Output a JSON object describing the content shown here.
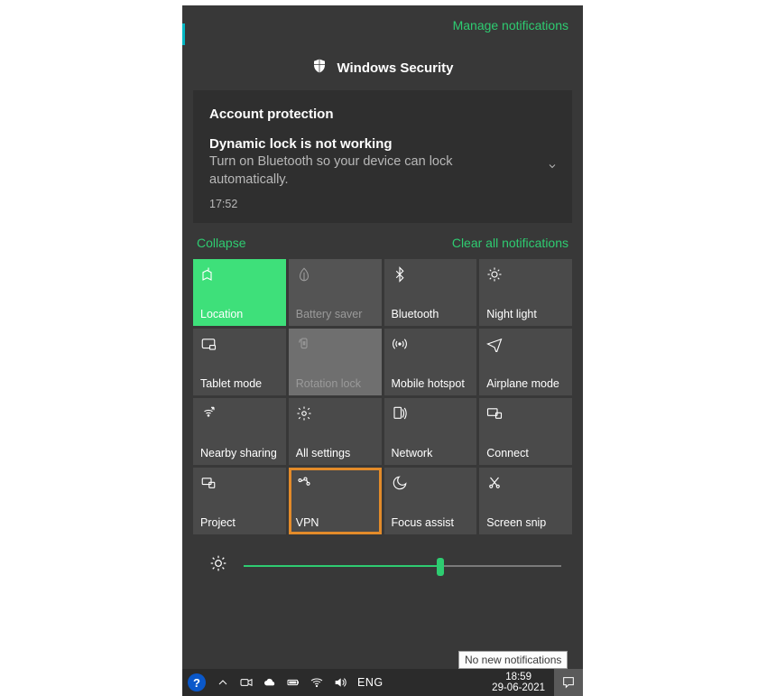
{
  "header": {
    "manage_link": "Manage notifications",
    "app_name": "Windows Security"
  },
  "notification": {
    "section": "Account protection",
    "title": "Dynamic lock is not working",
    "body": "Turn on Bluetooth so your device can lock automatically.",
    "time": "17:52"
  },
  "links": {
    "collapse": "Collapse",
    "clear": "Clear all notifications"
  },
  "tiles": [
    {
      "label": "Location",
      "icon": "location",
      "state": "active"
    },
    {
      "label": "Battery saver",
      "icon": "leaf",
      "state": "disabled"
    },
    {
      "label": "Bluetooth",
      "icon": "bluetooth",
      "state": "normal"
    },
    {
      "label": "Night light",
      "icon": "sun",
      "state": "normal"
    },
    {
      "label": "Tablet mode",
      "icon": "tablet",
      "state": "normal"
    },
    {
      "label": "Rotation lock",
      "icon": "rotation",
      "state": "light"
    },
    {
      "label": "Mobile hotspot",
      "icon": "hotspot",
      "state": "normal"
    },
    {
      "label": "Airplane mode",
      "icon": "airplane",
      "state": "normal"
    },
    {
      "label": "Nearby sharing",
      "icon": "share",
      "state": "normal"
    },
    {
      "label": "All settings",
      "icon": "gear",
      "state": "normal"
    },
    {
      "label": "Network",
      "icon": "network",
      "state": "normal"
    },
    {
      "label": "Connect",
      "icon": "connect",
      "state": "normal"
    },
    {
      "label": "Project",
      "icon": "project",
      "state": "normal"
    },
    {
      "label": "VPN",
      "icon": "vpn",
      "state": "outlined"
    },
    {
      "label": "Focus assist",
      "icon": "moon",
      "state": "normal"
    },
    {
      "label": "Screen snip",
      "icon": "snip",
      "state": "normal"
    }
  ],
  "brightness_percent": 62,
  "tooltip": "No new notifications",
  "taskbar": {
    "lang": "ENG",
    "time": "18:59",
    "date": "29-06-2021"
  }
}
